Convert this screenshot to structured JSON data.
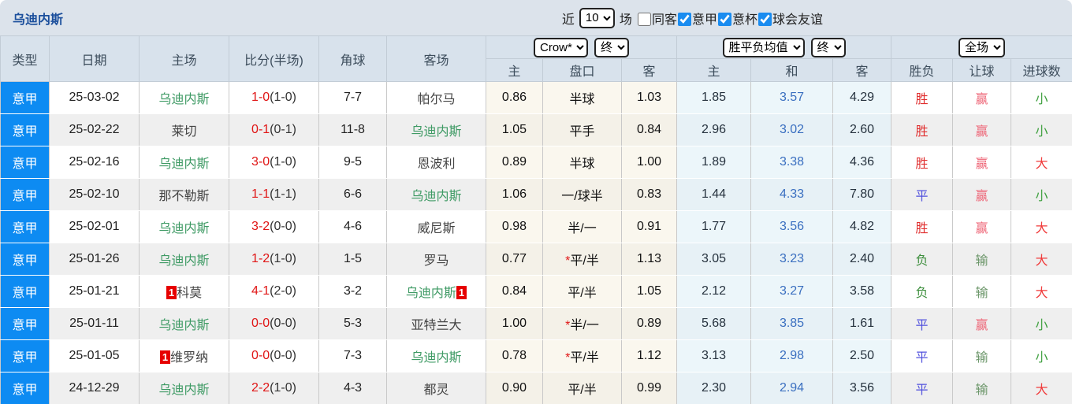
{
  "colors": {
    "league_badge_bg": "#0d8bf2",
    "title_blue": "#1b4f9c",
    "score_red": "#e01515",
    "team_green": "#3e9a64",
    "line_violet": "#8a8ac8",
    "draw_blue": "#3a6fc0",
    "red_card_bg": "#e60000",
    "checkbox_blue": "#1a8cf0"
  },
  "topbar": {
    "title": "乌迪内斯",
    "recent_label": "近",
    "recent_value": "10",
    "unit_label": "场",
    "filters": [
      {
        "label": "同客",
        "checked": false
      },
      {
        "label": "意甲",
        "checked": true
      },
      {
        "label": "意杯",
        "checked": true
      },
      {
        "label": "球会友谊",
        "checked": true
      }
    ]
  },
  "header": {
    "type": "类型",
    "date": "日期",
    "home": "主场",
    "score": "比分(半场)",
    "corners": "角球",
    "away": "客场",
    "odds_source_select": "Crow*",
    "odds_state_select": "终",
    "avg_select": "胜平负均值",
    "avg_state_select": "终",
    "scope_select": "全场",
    "sub": {
      "o_home": "主",
      "o_line": "盘口",
      "o_away": "客",
      "a_home": "主",
      "a_draw": "和",
      "a_away": "客",
      "r_outcome": "胜负",
      "r_handicap": "让球",
      "r_goals": "进球数"
    }
  },
  "table": {
    "rows": [
      {
        "league": "意甲",
        "date": "25-03-02",
        "home": "乌迪内斯",
        "home_green": true,
        "home_badge": "",
        "score": "1-0",
        "half": "(1-0)",
        "corners": "7-7",
        "away": "帕尔马",
        "away_green": false,
        "away_badge": "",
        "o_home": "0.86",
        "o_line": "半球",
        "o_star": false,
        "o_away": "1.03",
        "a_home": "1.85",
        "a_draw": "3.57",
        "a_away": "4.29",
        "r_outcome": "胜",
        "r_outcome_c": "red",
        "r_handicap": "赢",
        "r_handicap_c": "pink",
        "r_goals": "小",
        "r_goals_c": "bgreen"
      },
      {
        "league": "意甲",
        "date": "25-02-22",
        "home": "莱切",
        "home_green": false,
        "home_badge": "",
        "score": "0-1",
        "half": "(0-1)",
        "corners": "11-8",
        "away": "乌迪内斯",
        "away_green": true,
        "away_badge": "",
        "o_home": "1.05",
        "o_line": "平手",
        "o_star": false,
        "o_away": "0.84",
        "a_home": "2.96",
        "a_draw": "3.02",
        "a_away": "2.60",
        "r_outcome": "胜",
        "r_outcome_c": "red",
        "r_handicap": "赢",
        "r_handicap_c": "pink",
        "r_goals": "小",
        "r_goals_c": "bgreen"
      },
      {
        "league": "意甲",
        "date": "25-02-16",
        "home": "乌迪内斯",
        "home_green": true,
        "home_badge": "",
        "score": "3-0",
        "half": "(1-0)",
        "corners": "9-5",
        "away": "恩波利",
        "away_green": false,
        "away_badge": "",
        "o_home": "0.89",
        "o_line": "半球",
        "o_star": false,
        "o_away": "1.00",
        "a_home": "1.89",
        "a_draw": "3.38",
        "a_away": "4.36",
        "r_outcome": "胜",
        "r_outcome_c": "red",
        "r_handicap": "赢",
        "r_handicap_c": "pink",
        "r_goals": "大",
        "r_goals_c": "bred"
      },
      {
        "league": "意甲",
        "date": "25-02-10",
        "home": "那不勒斯",
        "home_green": false,
        "home_badge": "",
        "score": "1-1",
        "half": "(1-1)",
        "corners": "6-6",
        "away": "乌迪内斯",
        "away_green": true,
        "away_badge": "",
        "o_home": "1.06",
        "o_line": "一/球半",
        "o_star": false,
        "o_away": "0.83",
        "a_home": "1.44",
        "a_draw": "4.33",
        "a_away": "7.80",
        "r_outcome": "平",
        "r_outcome_c": "blue",
        "r_handicap": "赢",
        "r_handicap_c": "pink",
        "r_goals": "小",
        "r_goals_c": "bgreen"
      },
      {
        "league": "意甲",
        "date": "25-02-01",
        "home": "乌迪内斯",
        "home_green": true,
        "home_badge": "",
        "score": "3-2",
        "half": "(0-0)",
        "corners": "4-6",
        "away": "威尼斯",
        "away_green": false,
        "away_badge": "",
        "o_home": "0.98",
        "o_line": "半/一",
        "o_star": false,
        "o_away": "0.91",
        "a_home": "1.77",
        "a_draw": "3.56",
        "a_away": "4.82",
        "r_outcome": "胜",
        "r_outcome_c": "red",
        "r_handicap": "赢",
        "r_handicap_c": "pink",
        "r_goals": "大",
        "r_goals_c": "bred"
      },
      {
        "league": "意甲",
        "date": "25-01-26",
        "home": "乌迪内斯",
        "home_green": true,
        "home_badge": "",
        "score": "1-2",
        "half": "(1-0)",
        "corners": "1-5",
        "away": "罗马",
        "away_green": false,
        "away_badge": "",
        "o_home": "0.77",
        "o_line": "平/半",
        "o_star": true,
        "o_away": "1.13",
        "a_home": "3.05",
        "a_draw": "3.23",
        "a_away": "2.40",
        "r_outcome": "负",
        "r_outcome_c": "green",
        "r_handicap": "输",
        "r_handicap_c": "dgreen",
        "r_goals": "大",
        "r_goals_c": "bred"
      },
      {
        "league": "意甲",
        "date": "25-01-21",
        "home": "科莫",
        "home_green": false,
        "home_badge": "1",
        "score": "4-1",
        "half": "(2-0)",
        "corners": "3-2",
        "away": "乌迪内斯",
        "away_green": true,
        "away_badge": "1",
        "o_home": "0.84",
        "o_line": "平/半",
        "o_star": false,
        "o_away": "1.05",
        "a_home": "2.12",
        "a_draw": "3.27",
        "a_away": "3.58",
        "r_outcome": "负",
        "r_outcome_c": "green",
        "r_handicap": "输",
        "r_handicap_c": "dgreen",
        "r_goals": "大",
        "r_goals_c": "bred"
      },
      {
        "league": "意甲",
        "date": "25-01-11",
        "home": "乌迪内斯",
        "home_green": true,
        "home_badge": "",
        "score": "0-0",
        "half": "(0-0)",
        "corners": "5-3",
        "away": "亚特兰大",
        "away_green": false,
        "away_badge": "",
        "o_home": "1.00",
        "o_line": "半/一",
        "o_star": true,
        "o_away": "0.89",
        "a_home": "5.68",
        "a_draw": "3.85",
        "a_away": "1.61",
        "r_outcome": "平",
        "r_outcome_c": "blue",
        "r_handicap": "赢",
        "r_handicap_c": "pink",
        "r_goals": "小",
        "r_goals_c": "bgreen"
      },
      {
        "league": "意甲",
        "date": "25-01-05",
        "home": "维罗纳",
        "home_green": false,
        "home_badge": "1",
        "score": "0-0",
        "half": "(0-0)",
        "corners": "7-3",
        "away": "乌迪内斯",
        "away_green": true,
        "away_badge": "",
        "o_home": "0.78",
        "o_line": "平/半",
        "o_star": true,
        "o_away": "1.12",
        "a_home": "3.13",
        "a_draw": "2.98",
        "a_away": "2.50",
        "r_outcome": "平",
        "r_outcome_c": "blue",
        "r_handicap": "输",
        "r_handicap_c": "dgreen",
        "r_goals": "小",
        "r_goals_c": "bgreen"
      },
      {
        "league": "意甲",
        "date": "24-12-29",
        "home": "乌迪内斯",
        "home_green": true,
        "home_badge": "",
        "score": "2-2",
        "half": "(1-0)",
        "corners": "4-3",
        "away": "都灵",
        "away_green": false,
        "away_badge": "",
        "o_home": "0.90",
        "o_line": "平/半",
        "o_star": false,
        "o_away": "0.99",
        "a_home": "2.30",
        "a_draw": "2.94",
        "a_away": "3.56",
        "r_outcome": "平",
        "r_outcome_c": "blue",
        "r_handicap": "输",
        "r_handicap_c": "dgreen",
        "r_goals": "大",
        "r_goals_c": "bred"
      }
    ]
  }
}
